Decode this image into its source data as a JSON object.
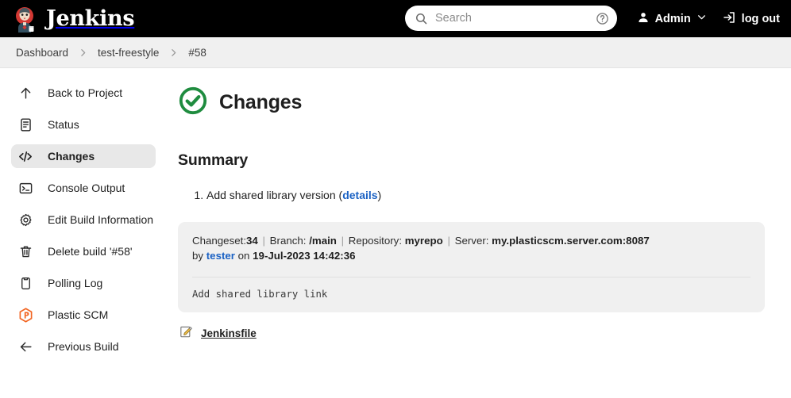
{
  "header": {
    "brand": "Jenkins",
    "brand_logo_icon": "jenkins-butler-logo",
    "search": {
      "placeholder": "Search",
      "value": "",
      "search_icon": "search-icon",
      "help_icon": "help-circle-icon"
    },
    "user": {
      "label": "Admin",
      "icon": "person-icon",
      "chevron": "chevron-down-icon"
    },
    "logout": {
      "label": "log out",
      "icon": "logout-arrow-icon"
    }
  },
  "breadcrumb": {
    "items": [
      {
        "label": "Dashboard"
      },
      {
        "label": "test-freestyle"
      },
      {
        "label": "#58"
      }
    ],
    "separator_icon": "chevron-right-icon"
  },
  "sidebar": {
    "items": [
      {
        "label": "Back to Project",
        "icon": "arrow-up-icon",
        "active": false
      },
      {
        "label": "Status",
        "icon": "document-icon",
        "active": false
      },
      {
        "label": "Changes",
        "icon": "code-brackets-icon",
        "active": true
      },
      {
        "label": "Console Output",
        "icon": "terminal-icon",
        "active": false
      },
      {
        "label": "Edit Build Information",
        "icon": "gear-icon",
        "active": false
      },
      {
        "label": "Delete build '#58'",
        "icon": "trash-icon",
        "active": false
      },
      {
        "label": "Polling Log",
        "icon": "clipboard-icon",
        "active": false
      },
      {
        "label": "Plastic SCM",
        "icon": "plastic-scm-logo-icon",
        "active": false
      },
      {
        "label": "Previous Build",
        "icon": "arrow-left-icon",
        "active": false
      }
    ]
  },
  "main": {
    "title": "Changes",
    "status_icon": "success-check-circle-icon",
    "summary_heading": "Summary",
    "summary_items": [
      {
        "text": "Add shared library version (",
        "link": "details",
        "text_after": ")"
      }
    ],
    "changeset": {
      "changeset_label": "Changeset:",
      "changeset_value": "34",
      "branch_label": "Branch: ",
      "branch_value": "/main",
      "repository_label": "Repository: ",
      "repository_value": "myrepo",
      "server_label": "Server: ",
      "server_value": "my.plasticscm.server.com:8087",
      "by_label": "by ",
      "author": "tester",
      "on_label": " on ",
      "timestamp": "19-Jul-2023 14:42:36",
      "message": "Add shared library link"
    },
    "affected_file": {
      "name": "Jenkinsfile",
      "icon": "edit-document-icon"
    }
  },
  "colors": {
    "header_bg": "#000000",
    "breadcrumb_bg": "#f0f0f0",
    "success_green": "#1f8c3f",
    "link_blue": "#1b62c4",
    "plastic_orange": "#f26522",
    "active_item_bg": "#e8e8e8"
  }
}
